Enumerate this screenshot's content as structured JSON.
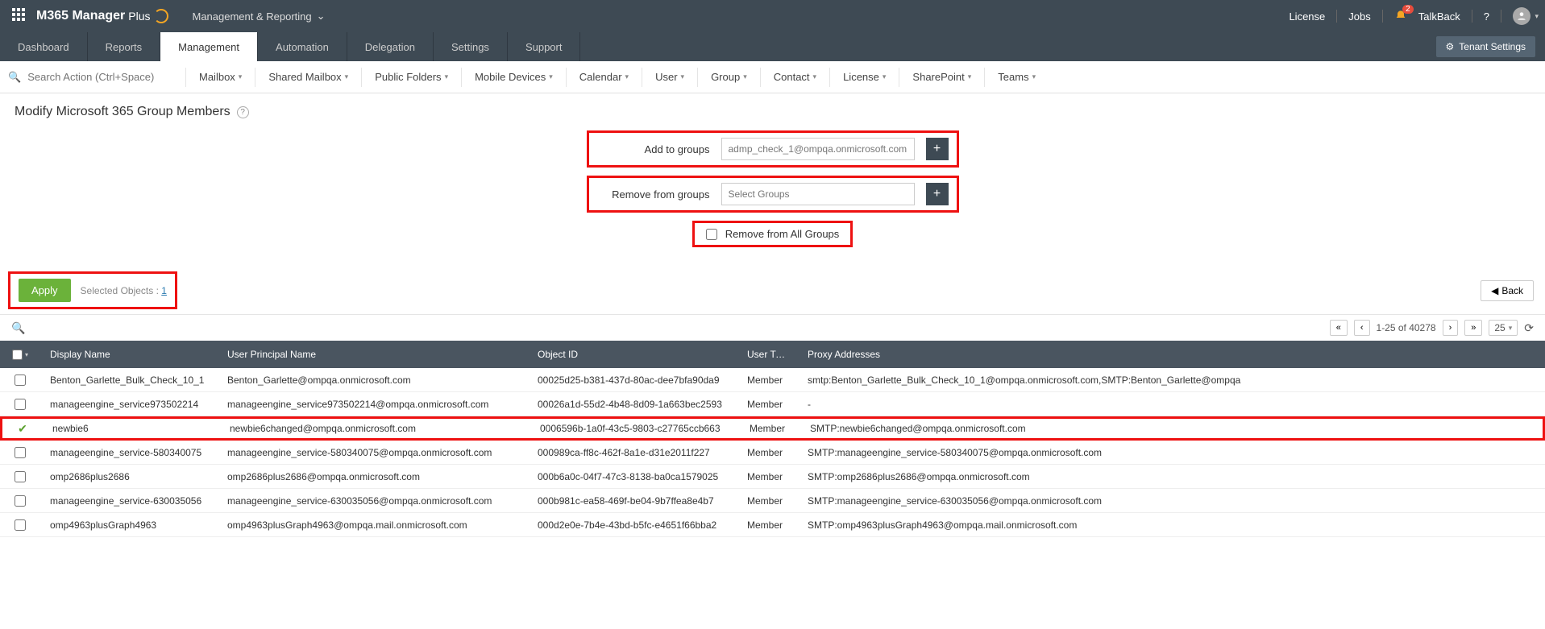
{
  "header": {
    "product": "M365 Manager",
    "product_suffix": "Plus",
    "top_menu": "Management & Reporting",
    "license": "License",
    "jobs": "Jobs",
    "notif_count": "2",
    "talkback": "TalkBack",
    "tenant_settings": "Tenant Settings"
  },
  "tabs": [
    "Dashboard",
    "Reports",
    "Management",
    "Automation",
    "Delegation",
    "Settings",
    "Support"
  ],
  "active_tab": 2,
  "search_placeholder": "Search Action (Ctrl+Space)",
  "subnav": [
    "Mailbox",
    "Shared Mailbox",
    "Public Folders",
    "Mobile Devices",
    "Calendar",
    "User",
    "Group",
    "Contact",
    "License",
    "SharePoint",
    "Teams"
  ],
  "page_title": "Modify Microsoft 365 Group Members",
  "form": {
    "add_label": "Add to groups",
    "add_value": "admp_check_1@ompqa.onmicrosoft.com",
    "remove_label": "Remove from groups",
    "remove_placeholder": "Select Groups",
    "remove_all_label": "Remove from All Groups"
  },
  "actions": {
    "apply": "Apply",
    "selected_label": "Selected Objects :",
    "selected_count": "1",
    "back": "Back"
  },
  "paging": {
    "range": "1-25 of 40278",
    "page_size": "25"
  },
  "columns": [
    "Display Name",
    "User Principal Name",
    "Object ID",
    "User Type",
    "Proxy Addresses"
  ],
  "rows": [
    {
      "checked": false,
      "dn": "Benton_Garlette_Bulk_Check_10_1",
      "upn": "Benton_Garlette@ompqa.onmicrosoft.com",
      "oid": "00025d25-b381-437d-80ac-dee7bfa90da9",
      "ut": "Member",
      "pa": "smtp:Benton_Garlette_Bulk_Check_10_1@ompqa.onmicrosoft.com,SMTP:Benton_Garlette@ompqa",
      "hl": false
    },
    {
      "checked": false,
      "dn": "manageengine_service973502214",
      "upn": "manageengine_service973502214@ompqa.onmicrosoft.com",
      "oid": "00026a1d-55d2-4b48-8d09-1a663bec2593",
      "ut": "Member",
      "pa": "-",
      "hl": false
    },
    {
      "checked": true,
      "dn": "newbie6",
      "upn": "newbie6changed@ompqa.onmicrosoft.com",
      "oid": "0006596b-1a0f-43c5-9803-c27765ccb663",
      "ut": "Member",
      "pa": "SMTP:newbie6changed@ompqa.onmicrosoft.com",
      "hl": true
    },
    {
      "checked": false,
      "dn": "manageengine_service-580340075",
      "upn": "manageengine_service-580340075@ompqa.onmicrosoft.com",
      "oid": "000989ca-ff8c-462f-8a1e-d31e2011f227",
      "ut": "Member",
      "pa": "SMTP:manageengine_service-580340075@ompqa.onmicrosoft.com",
      "hl": false
    },
    {
      "checked": false,
      "dn": "omp2686plus2686",
      "upn": "omp2686plus2686@ompqa.onmicrosoft.com",
      "oid": "000b6a0c-04f7-47c3-8138-ba0ca1579025",
      "ut": "Member",
      "pa": "SMTP:omp2686plus2686@ompqa.onmicrosoft.com",
      "hl": false
    },
    {
      "checked": false,
      "dn": "manageengine_service-630035056",
      "upn": "manageengine_service-630035056@ompqa.onmicrosoft.com",
      "oid": "000b981c-ea58-469f-be04-9b7ffea8e4b7",
      "ut": "Member",
      "pa": "SMTP:manageengine_service-630035056@ompqa.onmicrosoft.com",
      "hl": false
    },
    {
      "checked": false,
      "dn": "omp4963plusGraph4963",
      "upn": "omp4963plusGraph4963@ompqa.mail.onmicrosoft.com",
      "oid": "000d2e0e-7b4e-43bd-b5fc-e4651f66bba2",
      "ut": "Member",
      "pa": "SMTP:omp4963plusGraph4963@ompqa.mail.onmicrosoft.com",
      "hl": false
    }
  ]
}
